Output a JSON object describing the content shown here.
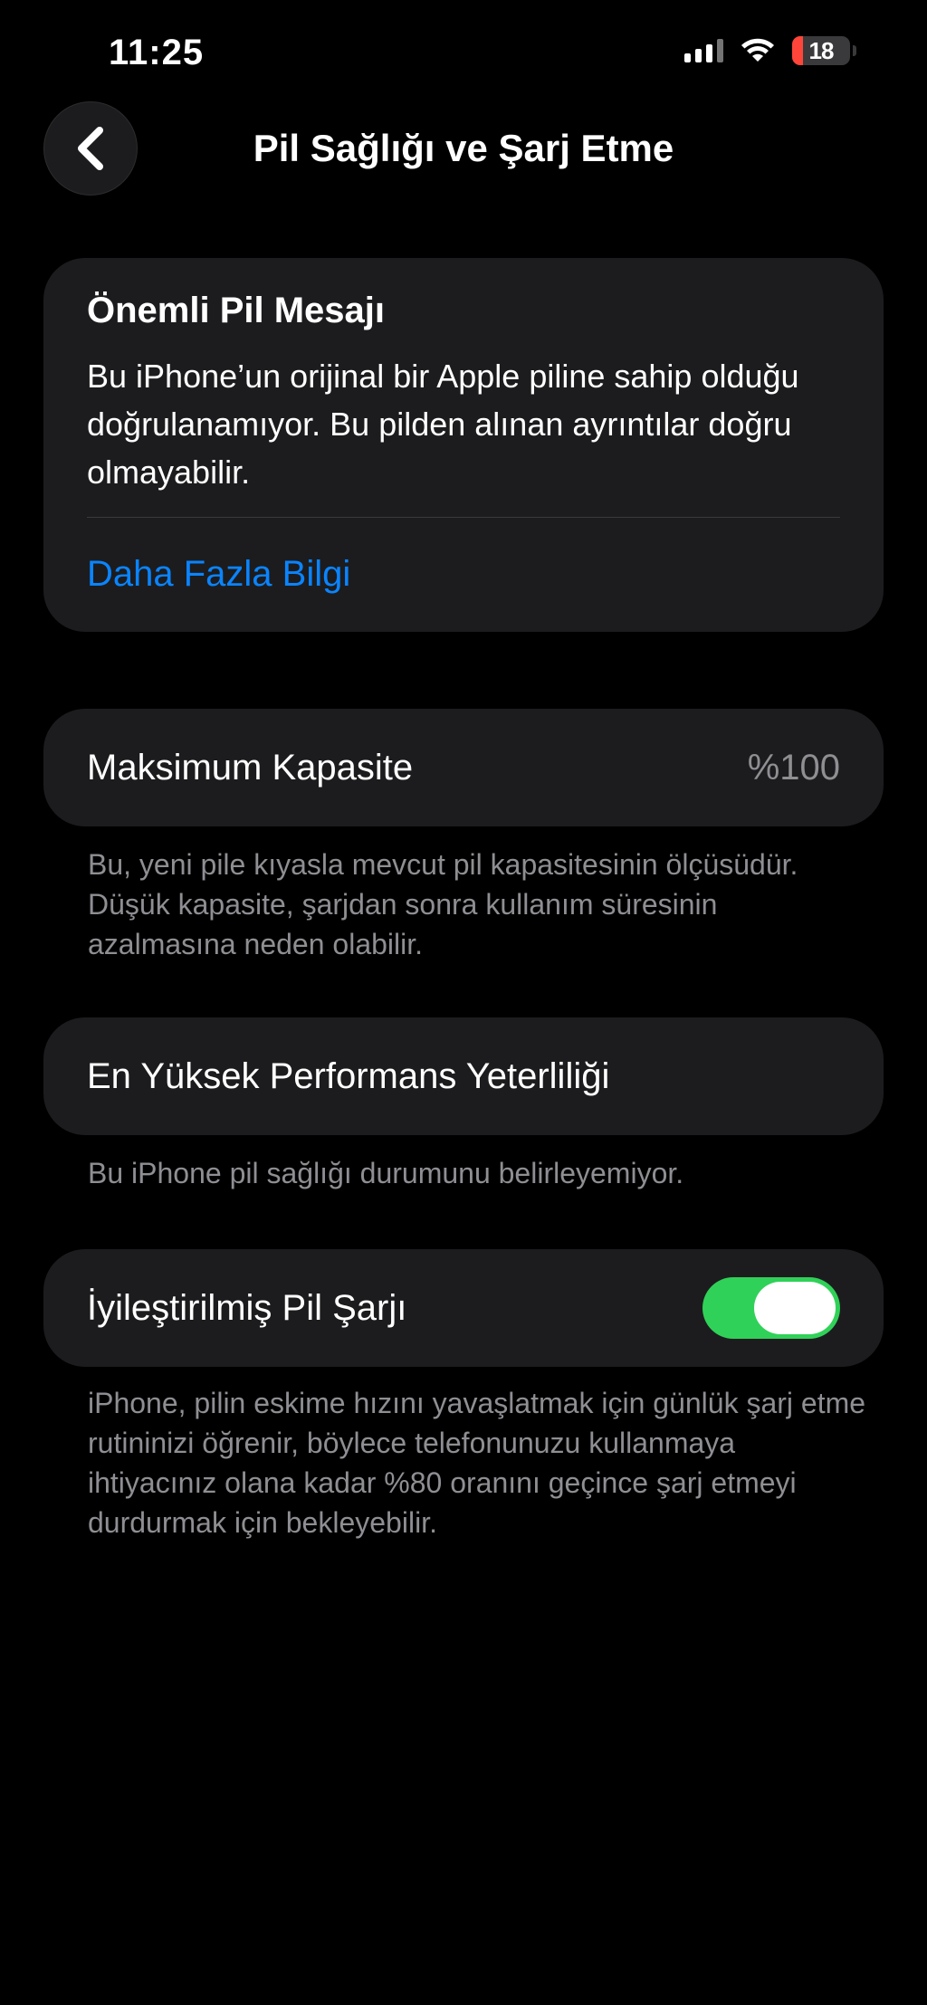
{
  "status_bar": {
    "time": "11:25",
    "battery_level": "18",
    "battery_fraction": 0.18,
    "battery_color": "#ff453a"
  },
  "nav": {
    "back_icon": "chevron-left-icon",
    "title": "Pil Sağlığı ve Şarj Etme"
  },
  "message_card": {
    "title": "Önemli Pil Mesajı",
    "body": "Bu iPhone’un orijinal bir Apple piline sahip olduğu doğrulanamıyor. Bu pilden alınan ayrıntılar doğru olmayabilir.",
    "link": "Daha Fazla Bilgi",
    "link_color": "#0a84ff"
  },
  "capacity": {
    "label": "Maksimum Kapasite",
    "value": "%100",
    "footnote": "Bu, yeni pile kıyasla mevcut pil kapasitesinin ölçüsüdür. Düşük kapasite, şarjdan sonra kullanım süresinin azalmasına neden olabilir."
  },
  "performance": {
    "label": "En Yüksek Performans Yeterliliği",
    "footnote": "Bu iPhone pil sağlığı durumunu belirleyemiyor."
  },
  "optimized_charging": {
    "label": "İyileştirilmiş Pil Şarjı",
    "enabled": true,
    "toggle_color": "#30d158",
    "footnote": "iPhone, pilin eskime hızını yavaşlatmak için günlük şarj etme rutininizi öğrenir, böylece telefonunuzu kullanmaya ihtiyacınız olana kadar %80 oranını geçince şarj etmeyi durdurmak için bekleyebilir."
  }
}
